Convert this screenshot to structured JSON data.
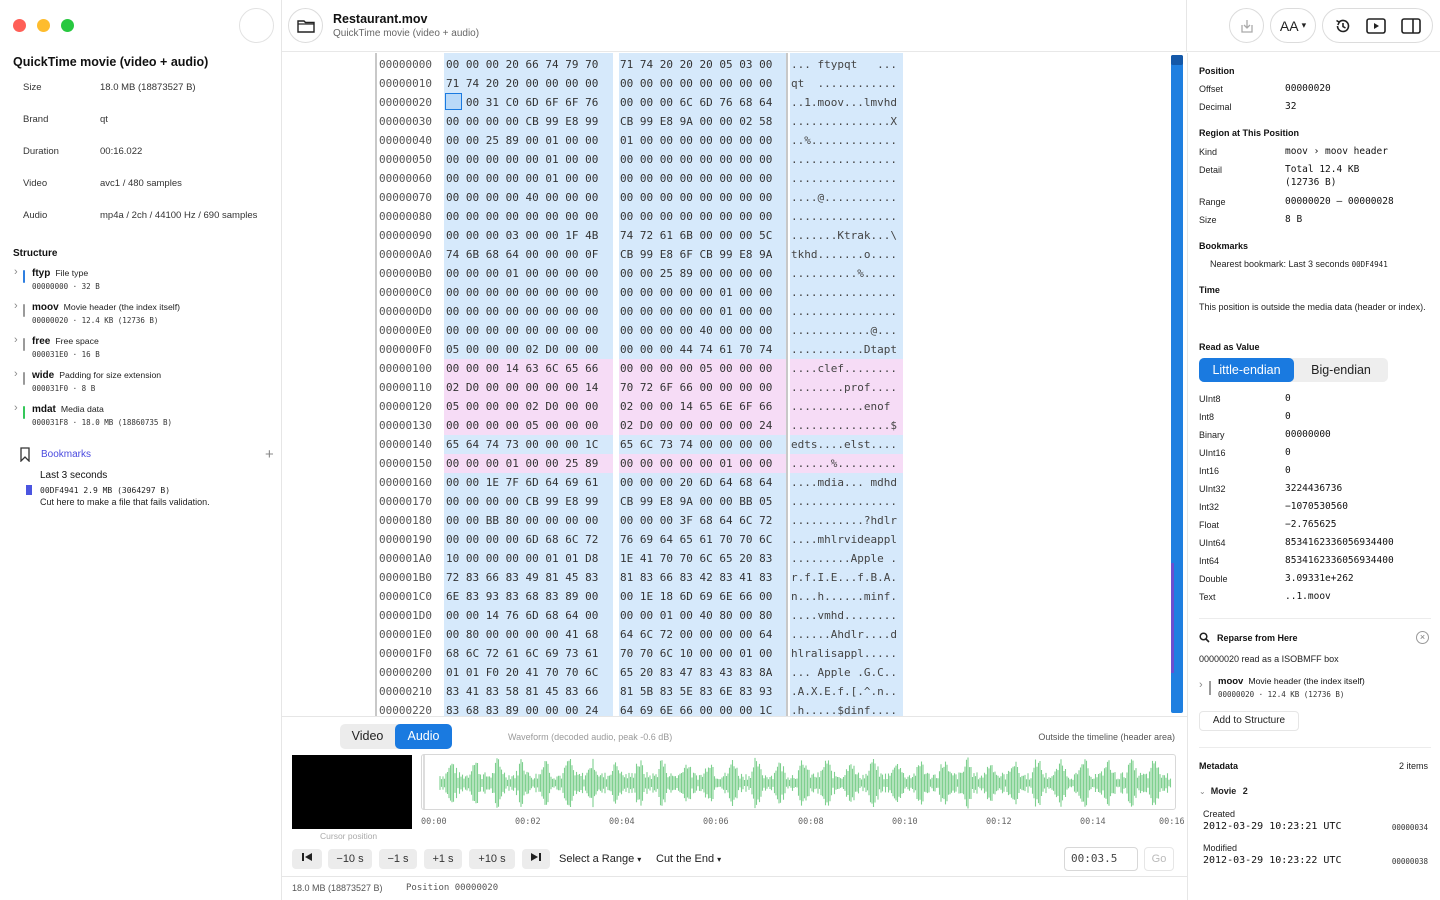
{
  "window": {
    "traffic_lights": [
      "#ff5f57",
      "#febc2e",
      "#28c840"
    ]
  },
  "sidebar": {
    "title": "QuickTime movie (video + audio)",
    "info": [
      {
        "key": "Size",
        "value": "18.0 MB (18873527 B)"
      },
      {
        "key": "Brand",
        "value": "qt"
      },
      {
        "key": "Duration",
        "value": "00:16.022"
      },
      {
        "key": "Video",
        "value": "avc1 / 480 samples"
      },
      {
        "key": "Audio",
        "value": "mp4a / 2ch / 44100 Hz / 690 samples"
      }
    ],
    "structure_heading": "Structure",
    "structure": [
      {
        "name": "ftyp",
        "desc": "File type",
        "sub": "00000000 · 32 B",
        "color": "#2f7fe0"
      },
      {
        "name": "moov",
        "desc": "Movie header (the index itself)",
        "sub": "00000020 · 12.4 KB (12736 B)",
        "color": "#9a9a9a"
      },
      {
        "name": "free",
        "desc": "Free space",
        "sub": "000031E0 · 16 B",
        "color": "#9a9a9a"
      },
      {
        "name": "wide",
        "desc": "Padding for size extension",
        "sub": "000031F0 · 8 B",
        "color": "#9a9a9a"
      },
      {
        "name": "mdat",
        "desc": "Media data",
        "sub": "000031F8 · 18.0 MB (18860735 B)",
        "color": "#34c759"
      }
    ],
    "bookmarks_label": "Bookmarks",
    "bookmark": {
      "title": "Last 3 seconds",
      "sub": "00DF4941  2.9 MB (3064297 B)",
      "note": "Cut here to make a file that fails validation."
    }
  },
  "file": {
    "name": "Restaurant.mov",
    "kind": "QuickTime movie (video + audio)"
  },
  "toolbar": {
    "text_size_label": "AA"
  },
  "hex": {
    "rows": [
      [
        "00000000",
        "00 00 00 20 66 74 79 70",
        "71 74 20 20 20 05 03 00",
        "... ftypqt   ..."
      ],
      [
        "00000010",
        "71 74 20 20 00 00 00 00",
        "00 00 00 00 00 00 00 00",
        "qt  ............"
      ],
      [
        "00000020",
        "00 00 31 C0 6D 6F 6F 76",
        "00 00 00 6C 6D 76 68 64",
        "..1.moov...lmvhd"
      ],
      [
        "00000030",
        "00 00 00 00 CB 99 E8 99",
        "CB 99 E8 9A 00 00 02 58",
        "...............X"
      ],
      [
        "00000040",
        "00 00 25 89 00 01 00 00",
        "01 00 00 00 00 00 00 00",
        "..%............."
      ],
      [
        "00000050",
        "00 00 00 00 00 01 00 00",
        "00 00 00 00 00 00 00 00",
        "................"
      ],
      [
        "00000060",
        "00 00 00 00 00 01 00 00",
        "00 00 00 00 00 00 00 00",
        "................"
      ],
      [
        "00000070",
        "00 00 00 00 40 00 00 00",
        "00 00 00 00 00 00 00 00",
        "....@..........."
      ],
      [
        "00000080",
        "00 00 00 00 00 00 00 00",
        "00 00 00 00 00 00 00 00",
        "................"
      ],
      [
        "00000090",
        "00 00 00 03 00 00 1F 4B",
        "74 72 61 6B 00 00 00 5C",
        ".......Ktrak...\\"
      ],
      [
        "000000A0",
        "74 6B 68 64 00 00 00 0F",
        "CB 99 E8 6F CB 99 E8 9A",
        "tkhd.......o...."
      ],
      [
        "000000B0",
        "00 00 00 01 00 00 00 00",
        "00 00 25 89 00 00 00 00",
        "..........%....."
      ],
      [
        "000000C0",
        "00 00 00 00 00 00 00 00",
        "00 00 00 00 00 01 00 00",
        "................"
      ],
      [
        "000000D0",
        "00 00 00 00 00 00 00 00",
        "00 00 00 00 00 01 00 00",
        "................"
      ],
      [
        "000000E0",
        "00 00 00 00 00 00 00 00",
        "00 00 00 00 40 00 00 00",
        "............@..."
      ],
      [
        "000000F0",
        "05 00 00 00 02 D0 00 00",
        "00 00 00 44 74 61 70 74",
        "...........Dtapt"
      ],
      [
        "00000100",
        "00 00 00 14 63 6C 65 66",
        "00 00 00 00 05 00 00 00",
        "....clef........"
      ],
      [
        "00000110",
        "02 D0 00 00 00 00 00 14",
        "70 72 6F 66 00 00 00 00",
        "........prof...."
      ],
      [
        "00000120",
        "05 00 00 00 02 D0 00 00",
        "02 00 00 14 65 6E 6F 66",
        "...........enof"
      ],
      [
        "00000130",
        "00 00 00 00 05 00 00 00",
        "02 D0 00 00 00 00 00 24",
        "...............$"
      ],
      [
        "00000140",
        "65 64 74 73 00 00 00 1C",
        "65 6C 73 74 00 00 00 00",
        "edts....elst...."
      ],
      [
        "00000150",
        "00 00 00 01 00 00 25 89",
        "00 00 00 00 00 01 00 00",
        "......%........."
      ],
      [
        "00000160",
        "00 00 1E 7F 6D 64 69 61",
        "00 00 00 20 6D 64 68 64",
        "....mdia... mdhd"
      ],
      [
        "00000170",
        "00 00 00 00 CB 99 E8 99",
        "CB 99 E8 9A 00 00 BB 05",
        "................"
      ],
      [
        "00000180",
        "00 00 BB 80 00 00 00 00",
        "00 00 00 3F 68 64 6C 72",
        "...........?hdlr"
      ],
      [
        "00000190",
        "00 00 00 00 6D 68 6C 72",
        "76 69 64 65 61 70 70 6C",
        "....mhlrvideappl"
      ],
      [
        "000001A0",
        "10 00 00 00 00 01 01 D8",
        "1E 41 70 70 6C 65 20 83",
        ".........Apple ."
      ],
      [
        "000001B0",
        "72 83 66 83 49 81 45 83",
        "81 83 66 83 42 83 41 83",
        "r.f.I.E...f.B.A."
      ],
      [
        "000001C0",
        "6E 83 93 83 68 83 89 00",
        "00 1E 18 6D 69 6E 66 00",
        "n...h......minf."
      ],
      [
        "000001D0",
        "00 00 14 76 6D 68 64 00",
        "00 00 01 00 40 80 00 80",
        "....vmhd........"
      ],
      [
        "000001E0",
        "00 80 00 00 00 00 41 68",
        "64 6C 72 00 00 00 00 64",
        "......Ahdlr....d"
      ],
      [
        "000001F0",
        "68 6C 72 61 6C 69 73 61",
        "70 70 6C 10 00 00 01 00",
        "hlralisappl....."
      ],
      [
        "00000200",
        "01 01 F0 20 41 70 70 6C",
        "65 20 83 47 83 43 83 8A",
        "... Apple .G.C.."
      ],
      [
        "00000210",
        "83 41 83 58 81 45 83 66",
        "81 5B 83 5E 83 6E 83 93",
        ".A.X.E.f.[.^.n.."
      ],
      [
        "00000220",
        "83 68 83 89 00 00 00 24",
        "64 69 6E 66 00 00 00 1C",
        ".h.....$dinf...."
      ]
    ]
  },
  "media": {
    "tabs": [
      "Video",
      "Audio"
    ],
    "waveform_label": "Waveform (decoded audio, peak -0.6 dB)",
    "outside_label": "Outside the timeline (header area)",
    "cursor_label": "Cursor position",
    "ticks": [
      "00:00",
      "00:02",
      "00:04",
      "00:06",
      "00:08",
      "00:10",
      "00:12",
      "00:14",
      "00:16"
    ],
    "controls": {
      "back_10": "−10 s",
      "back_1": "−1 s",
      "fwd_1": "+1 s",
      "fwd_10": "+10 s",
      "select_range": "Select a Range",
      "cut_end": "Cut the End",
      "time": "00:03.5",
      "go": "Go"
    },
    "waveform_color": "#7fd08f"
  },
  "status": {
    "size": "18.0 MB (18873527 B)",
    "position": "Position 00000020"
  },
  "inspector": {
    "position": {
      "heading": "Position",
      "offset_key": "Offset",
      "offset": "00000020",
      "decimal_key": "Decimal",
      "decimal": "32"
    },
    "region": {
      "heading": "Region at This Position",
      "kind_key": "Kind",
      "kind": "moov › moov header",
      "detail_key": "Detail",
      "detail": "Total 12.4 KB\n(12736 B)",
      "range_key": "Range",
      "range": "00000020 – 00000028",
      "size_key": "Size",
      "size": "8 B"
    },
    "bookmarks": {
      "heading": "Bookmarks",
      "nearest": "Nearest bookmark: Last 3 seconds",
      "nearest_offset": "00DF4941"
    },
    "time": {
      "heading": "Time",
      "text": "This position is outside the media data (header or index)."
    },
    "read_value": {
      "heading": "Read as Value",
      "le": "Little-endian",
      "be": "Big-endian",
      "rows": [
        [
          "UInt8",
          "0"
        ],
        [
          "Int8",
          "0"
        ],
        [
          "Binary",
          "00000000"
        ],
        [
          "UInt16",
          "0"
        ],
        [
          "Int16",
          "0"
        ],
        [
          "UInt32",
          "3224436736"
        ],
        [
          "Int32",
          "−1070530560"
        ],
        [
          "Float",
          "−2.765625"
        ],
        [
          "UInt64",
          "8534162336056934400"
        ],
        [
          "Int64",
          "8534162336056934400"
        ],
        [
          "Double",
          "3.09331e+262"
        ],
        [
          "Text",
          "..1.moov"
        ]
      ]
    },
    "reparse": {
      "heading": "Reparse from Here",
      "line": "00000020 read as a ISOBMFF box",
      "box_name": "moov",
      "box_desc": "Movie header (the index itself)",
      "box_sub": "00000020 · 12.4 KB (12736 B)",
      "add_label": "Add to Structure"
    },
    "metadata": {
      "heading": "Metadata",
      "count": "2 items",
      "group": "Movie",
      "group_count": "2",
      "items": [
        {
          "label": "Created",
          "value": "2012-03-29 10:23:21 UTC",
          "offset": "00000034"
        },
        {
          "label": "Modified",
          "value": "2012-03-29 10:23:22 UTC",
          "offset": "00000038"
        }
      ]
    }
  }
}
